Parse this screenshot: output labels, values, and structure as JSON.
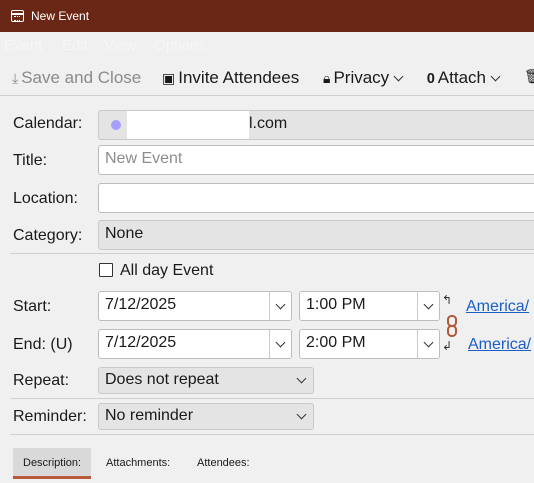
{
  "window": {
    "title": "New Event"
  },
  "menu": {
    "items": [
      "Event",
      "Edit",
      "View",
      "Options"
    ]
  },
  "toolbar": {
    "save_close": "Save and Close",
    "invite": "Invite Attendees",
    "privacy": "Privacy",
    "attach": "Attach"
  },
  "form": {
    "calendar_label": "Calendar:",
    "calendar_value": "l.com",
    "calendar_color": "#a3a0ff",
    "title_label": "Title:",
    "title_placeholder": "New Event",
    "location_label": "Location:",
    "location_value": "",
    "category_label": "Category:",
    "category_value": "None",
    "allday_label": "All day Event",
    "start_label": "Start:",
    "start_date": "7/12/2025",
    "start_time": "1:00 PM",
    "start_tz": "America/",
    "end_label": "End: (U)",
    "end_date": "7/12/2025",
    "end_time": "2:00 PM",
    "end_tz": "America/",
    "repeat_label": "Repeat:",
    "repeat_value": "Does not repeat",
    "reminder_label": "Reminder:",
    "reminder_value": "No reminder"
  },
  "tabs": [
    {
      "label": "Description:",
      "active": true
    },
    {
      "label": "Attachments:",
      "active": false
    },
    {
      "label": "Attendees:",
      "active": false
    }
  ]
}
